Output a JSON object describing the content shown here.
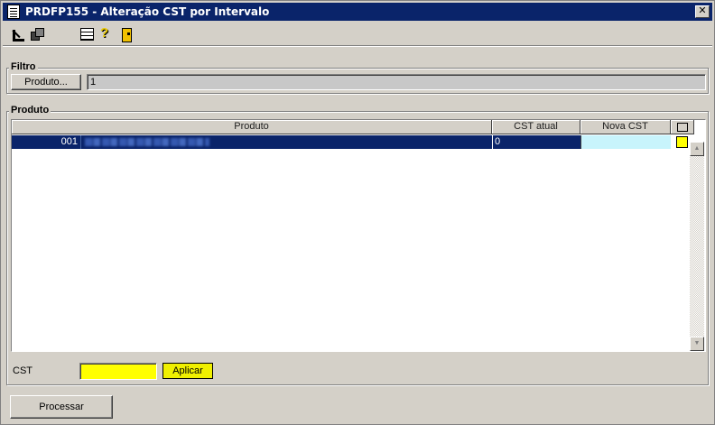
{
  "window": {
    "title": "PRDFP155 - Alteração CST por Intervalo",
    "close_label": "✕"
  },
  "toolbar": {
    "icons": [
      "back-arrow-icon",
      "windows-icon",
      "calculator-icon",
      "help-icon",
      "exit-door-icon"
    ]
  },
  "filtro": {
    "group_label": "Filtro",
    "produto_button_label": "Produto...",
    "produto_value": "1"
  },
  "produto": {
    "group_label": "Produto",
    "columns": [
      "Produto",
      "CST atual",
      "Nova CST"
    ],
    "rows": [
      {
        "codigo": "001",
        "cst_atual": "0",
        "nova_cst": "",
        "checked": true
      }
    ]
  },
  "cst": {
    "label": "CST",
    "value": "",
    "aplicar_label": "Aplicar"
  },
  "processar_label": "Processar",
  "colors": {
    "titlebar": "#0a246a",
    "selection": "#0a246a",
    "nova_cst_cell": "#c8f4fc",
    "highlight_yellow": "#ffff00",
    "window_bg": "#d4d0c8"
  }
}
